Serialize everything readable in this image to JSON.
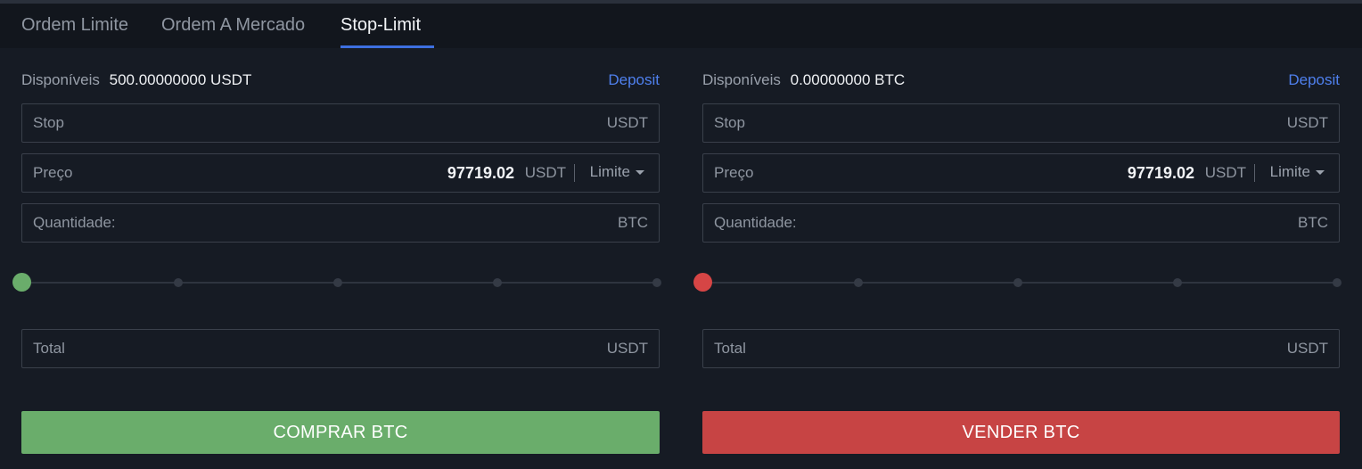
{
  "tabs": [
    {
      "label": "Ordem Limite",
      "active": false
    },
    {
      "label": "Ordem A Mercado",
      "active": false
    },
    {
      "label": "Stop-Limit",
      "active": true
    }
  ],
  "buy": {
    "available_label": "Disponíveis",
    "available_value": "500.00000000 USDT",
    "deposit_label": "Deposit",
    "stop": {
      "label": "Stop",
      "unit": "USDT",
      "value": ""
    },
    "price": {
      "label": "Preço",
      "value": "97719.02",
      "unit": "USDT",
      "type": "Limite"
    },
    "quantity": {
      "label": "Quantidade:",
      "unit": "BTC",
      "value": ""
    },
    "slider_percent": 0,
    "total": {
      "label": "Total",
      "unit": "USDT",
      "value": ""
    },
    "button_label": "COMPRAR BTC"
  },
  "sell": {
    "available_label": "Disponíveis",
    "available_value": "0.00000000 BTC",
    "deposit_label": "Deposit",
    "stop": {
      "label": "Stop",
      "unit": "USDT",
      "value": ""
    },
    "price": {
      "label": "Preço",
      "value": "97719.02",
      "unit": "USDT",
      "type": "Limite"
    },
    "quantity": {
      "label": "Quantidade:",
      "unit": "BTC",
      "value": ""
    },
    "slider_percent": 0,
    "total": {
      "label": "Total",
      "unit": "USDT",
      "value": ""
    },
    "button_label": "VENDER BTC"
  },
  "colors": {
    "buy": "#6aad6b",
    "sell": "#c74444",
    "accent": "#3d6fe0",
    "deposit_link": "#4f80ee"
  }
}
